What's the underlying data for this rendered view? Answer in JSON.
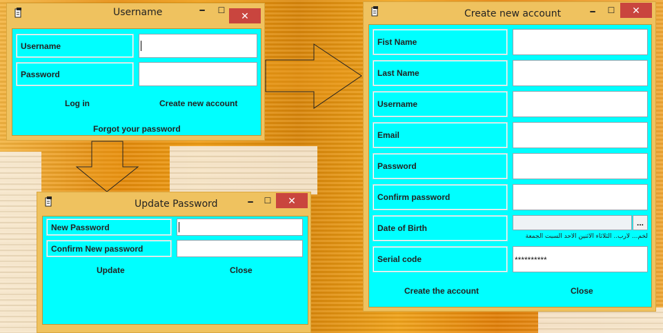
{
  "login": {
    "title": "Username",
    "username_label": "Username",
    "password_label": "Password",
    "username_value": "",
    "password_value": "",
    "login_btn": "Log in",
    "create_btn": "Create new account",
    "forgot_btn": "Forgot your password",
    "controls": {
      "minimize": "━",
      "maximize": "☐",
      "close": "✕"
    }
  },
  "update": {
    "title": "Update Password",
    "new_password_label": "New Password",
    "confirm_label": "Confirm New password",
    "new_password_value": "",
    "confirm_value": "",
    "update_btn": "Update",
    "close_btn": "Close",
    "controls": {
      "minimize": "━",
      "maximize": "☐",
      "close": "✕"
    }
  },
  "create": {
    "title": "Create new account",
    "fields": [
      {
        "label": "Fist Name",
        "value": ""
      },
      {
        "label": "Last Name",
        "value": ""
      },
      {
        "label": "Username",
        "value": ""
      },
      {
        "label": "Email",
        "value": ""
      },
      {
        "label": "Password",
        "value": ""
      },
      {
        "label": "Confirm password",
        "value": ""
      }
    ],
    "dob_label": "Date of Birth",
    "dob_value": "",
    "dob_button": "...",
    "dob_weekdays": "لخم... لأرب.. الثلاثاء الاثنين الأحد السبت الجمعة",
    "serial_label": "Serial code",
    "serial_value": "**********",
    "create_btn": "Create the account",
    "close_btn": "Close",
    "controls": {
      "minimize": "━",
      "maximize": "☐",
      "close": "✕"
    }
  },
  "icons": [
    "app-icon",
    "minimize-icon",
    "maximize-icon",
    "close-icon",
    "flow-arrow-right",
    "flow-arrow-down"
  ]
}
